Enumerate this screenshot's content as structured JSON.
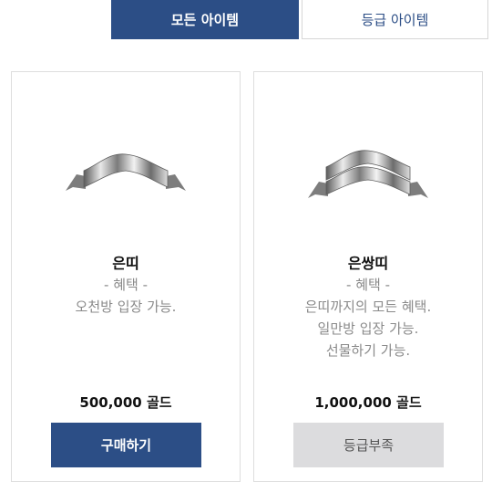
{
  "tabs": {
    "all_items": "모든 아이템",
    "grade_items": "등급 아이템"
  },
  "items": [
    {
      "name": "은띠",
      "benefit_header": "- 혜택 -",
      "benefits": [
        "오천방 입장 가능."
      ],
      "price": "500,000 골드",
      "button": "구매하기"
    },
    {
      "name": "은쌍띠",
      "benefit_header": "- 혜택 -",
      "benefits": [
        "은띠까지의 모든 혜택.",
        "일만방 입장 가능.",
        "선물하기 가능."
      ],
      "price": "1,000,000 골드",
      "button": "등급부족"
    }
  ],
  "colors": {
    "accent": "#2c4e86",
    "disabled_button": "#dcdcde"
  }
}
